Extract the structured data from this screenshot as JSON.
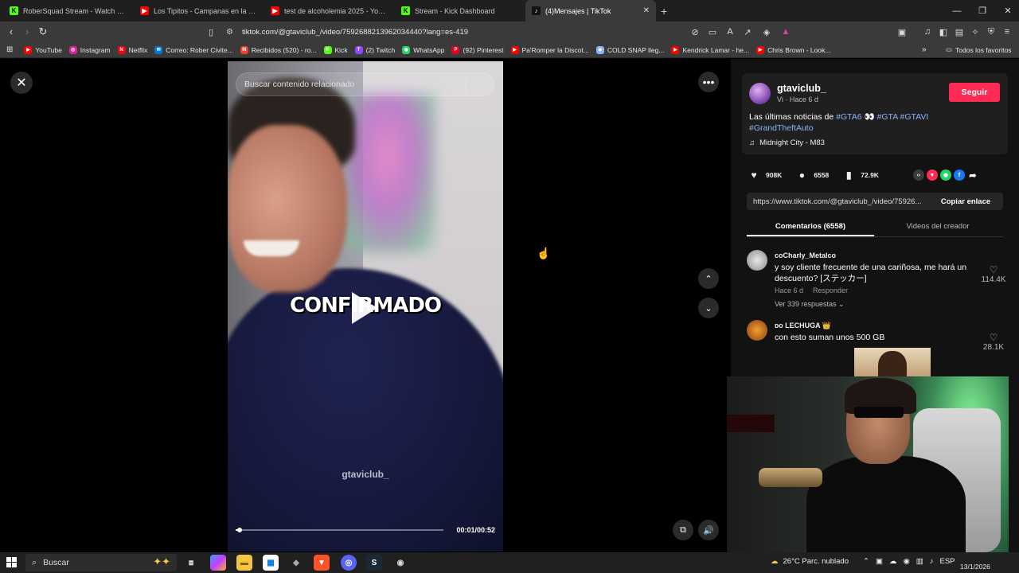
{
  "browser": {
    "tabs": [
      {
        "title": "RoberSquad Stream - Watch Live",
        "color": "#53fc18",
        "glyph": "K"
      },
      {
        "title": "Los Tipitos - Campanas en la noche (",
        "color": "#ff0000",
        "glyph": "▶"
      },
      {
        "title": "test de alcoholemia 2025 - YouTube",
        "color": "#ff0000",
        "glyph": "▶"
      },
      {
        "title": "Stream - Kick Dashboard",
        "color": "#53fc18",
        "glyph": "K"
      },
      {
        "title": "(4)Mensajes | TikTok",
        "color": "#111111",
        "glyph": "♪"
      }
    ],
    "url": "tiktok.com/@gtaviclub_/video/7592688213962034440?lang=es-419",
    "bookmarks": [
      {
        "label": "YouTube",
        "color": "#ff0000",
        "glyph": "▶"
      },
      {
        "label": "Instagram",
        "color": "#d6249f",
        "glyph": "◎"
      },
      {
        "label": "Netflix",
        "color": "#e50914",
        "glyph": "N"
      },
      {
        "label": "Correo: Rober Civite...",
        "color": "#0078d4",
        "glyph": "✉"
      },
      {
        "label": "Recibidos (520) - ro...",
        "color": "#ea4335",
        "glyph": "M"
      },
      {
        "label": "Kick",
        "color": "#53fc18",
        "glyph": "K"
      },
      {
        "label": "(2) Twitch",
        "color": "#9146ff",
        "glyph": "T"
      },
      {
        "label": "WhatsApp",
        "color": "#25d366",
        "glyph": "◉"
      },
      {
        "label": "(92) Pinterest",
        "color": "#e60023",
        "glyph": "P"
      },
      {
        "label": "Pa'Romper la Discot...",
        "color": "#ff0000",
        "glyph": "▶"
      },
      {
        "label": "COLD SNAP lleg...",
        "color": "#8ab4f8",
        "glyph": "◆"
      },
      {
        "label": "Kendrick Lamar - he...",
        "color": "#ff0000",
        "glyph": "▶"
      },
      {
        "label": "Chris Brown - Look...",
        "color": "#ff0000",
        "glyph": "▶"
      }
    ],
    "bookmarks_more": "»",
    "all_bookmarks": "Todos los favoritos"
  },
  "video": {
    "search_placeholder": "Buscar contenido relacionado",
    "overlay_text": "CONFIRMADO",
    "watermark": "gtaviclub_",
    "time": "00:01/00:52",
    "progress": 0.02
  },
  "post": {
    "author": "gtaviclub_",
    "meta": "Vi · Hace 6 d",
    "follow": "Seguir",
    "desc_text": "Las últimas noticias de ",
    "tags_line1": [
      "#GTA6"
    ],
    "emoji": "👀",
    "tags_line1b": [
      "#GTA",
      "#GTAVI"
    ],
    "tag_line2": "#GrandTheftAuto",
    "music": "Midnight City - M83",
    "likes": "908K",
    "comments": "6558",
    "saves": "72.9K",
    "link": "https://www.tiktok.com/@gtaviclub_/video/75926...",
    "copy_link": "Copiar enlace",
    "tab_comments": "Comentarios (6558)",
    "tab_videos": "Videos del creador"
  },
  "comments": [
    {
      "user": "coCharly_Metalco",
      "text": "y soy cliente frecuente de una cariñosa, me hará un descuento? [ステッカー]",
      "time": "Hace 6 d",
      "reply": "Responder",
      "replies": "Ver 339 respuestas ⌄",
      "likes": "114.4K"
    },
    {
      "user": "ᴅᴏ LECHUGA 👑",
      "text": "con esto suman unos 500 GB",
      "likes": "28.1K"
    }
  ],
  "taskbar": {
    "search": "Buscar",
    "weather": "26°C  Parc. nublado",
    "lang": "ESP",
    "date": "13/1/2026"
  }
}
